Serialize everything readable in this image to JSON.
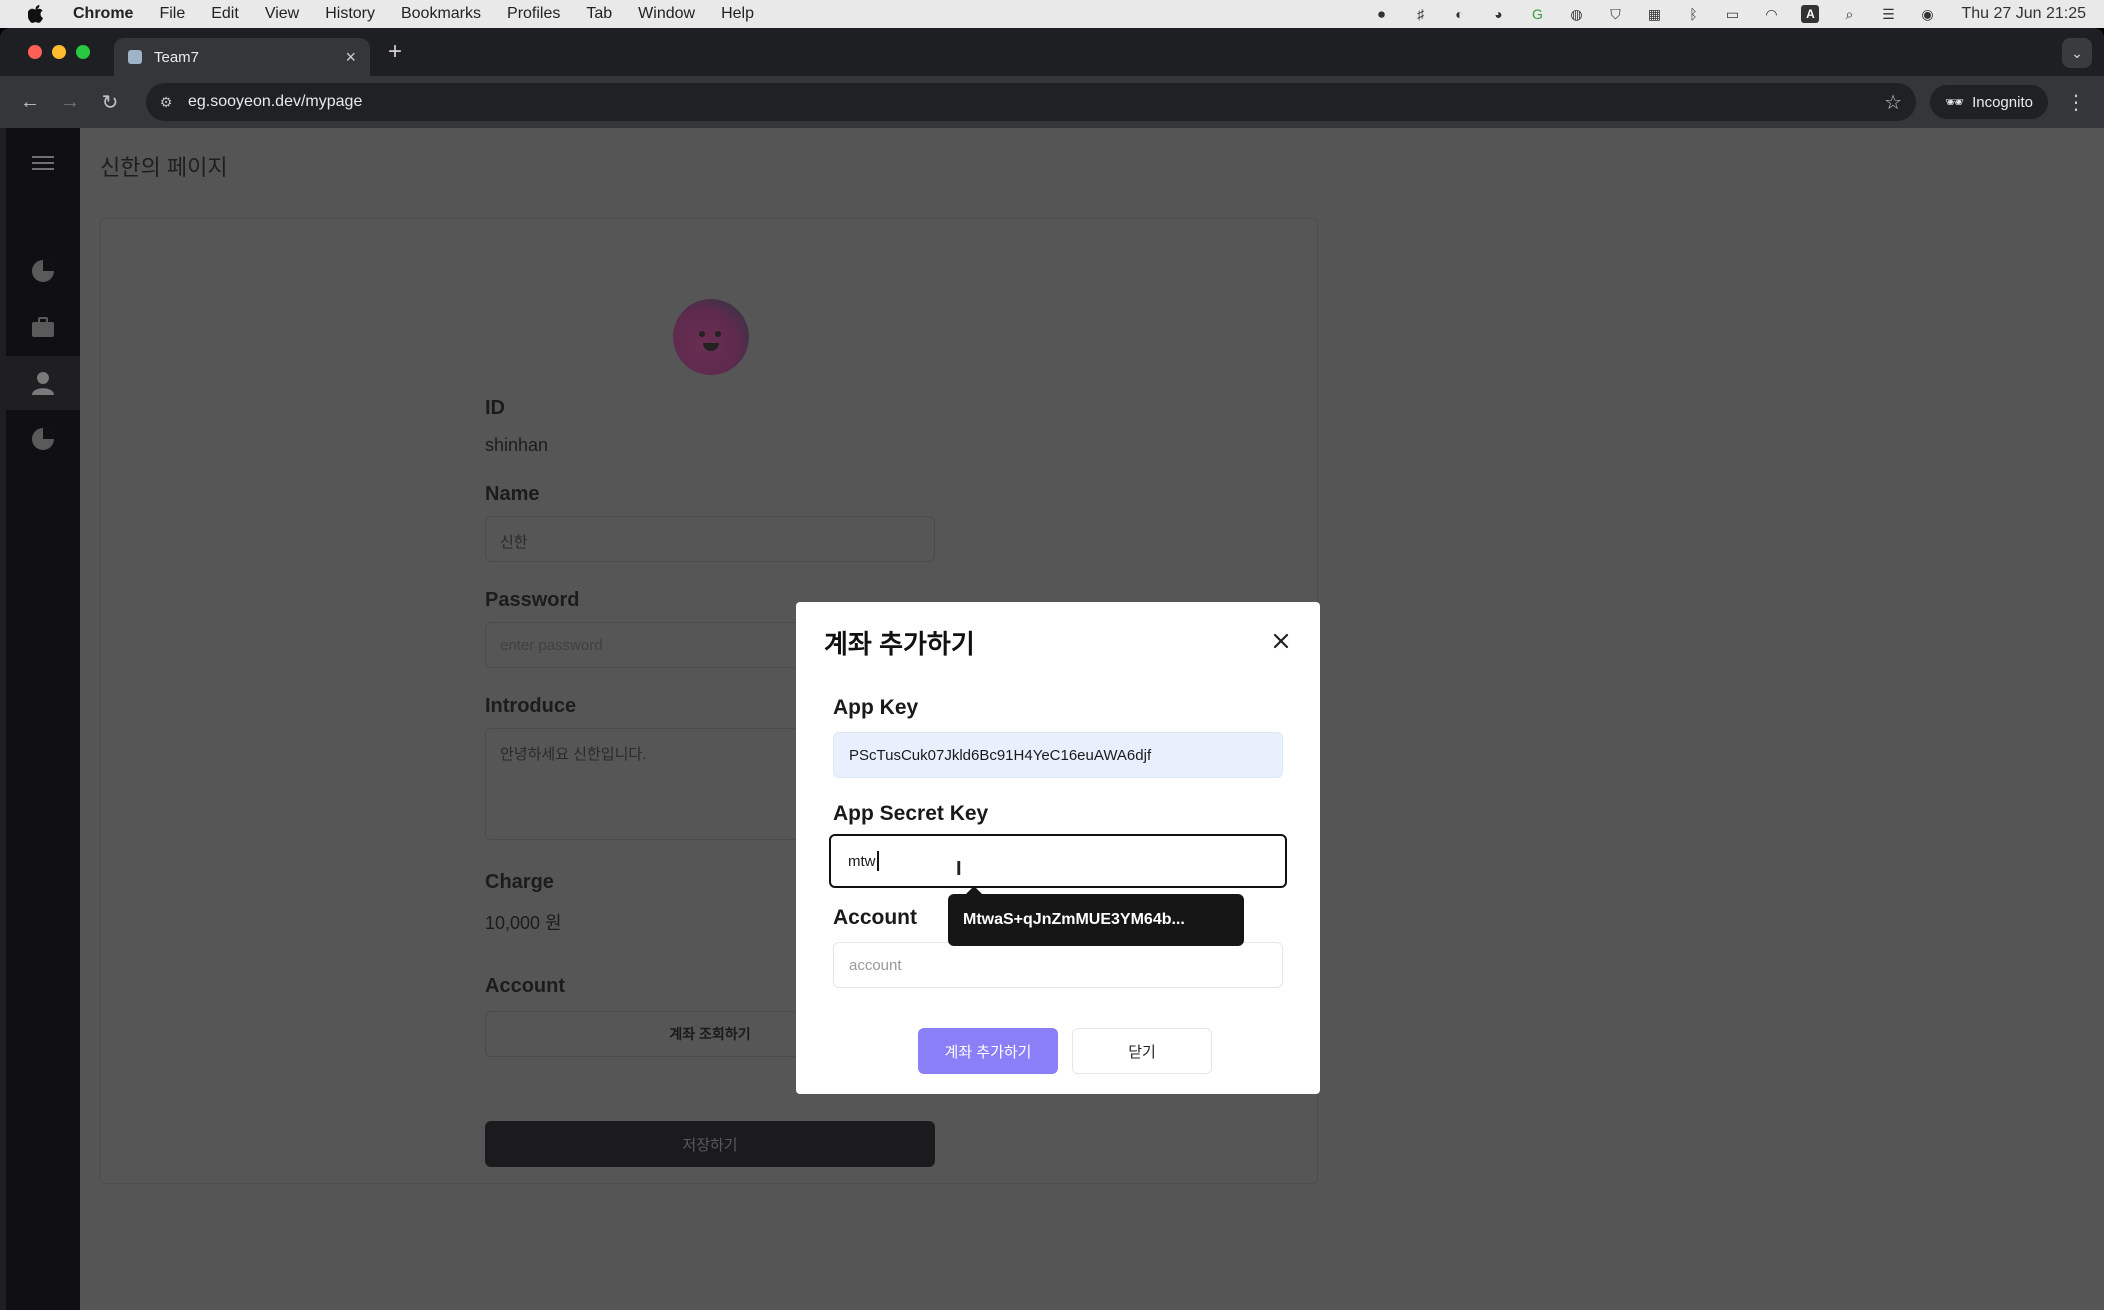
{
  "menubar": {
    "app": "Chrome",
    "items": [
      "File",
      "Edit",
      "View",
      "History",
      "Bookmarks",
      "Profiles",
      "Tab",
      "Window",
      "Help"
    ],
    "clock": "Thu 27 Jun  21:25"
  },
  "browser": {
    "tab_title": "Team7",
    "url": "eg.sooyeon.dev/mypage",
    "incognito_label": "Incognito"
  },
  "page": {
    "title": "신한의 페이지",
    "id_label": "ID",
    "id_value": "shinhan",
    "name_label": "Name",
    "name_value": "신한",
    "password_label": "Password",
    "password_placeholder": "enter password",
    "introduce_label": "Introduce",
    "introduce_value": "안녕하세요 신한입니다.",
    "charge_label": "Charge",
    "charge_value": "10,000 원",
    "account_label": "Account",
    "account_button": "계좌 조회하기",
    "save_button": "저장하기"
  },
  "modal": {
    "title": "계좌 추가하기",
    "app_key_label": "App Key",
    "app_key_value": "PScTusCuk07Jkld6Bc91H4YeC16euAWA6djf",
    "secret_label": "App Secret Key",
    "secret_value": "mtw",
    "autocomplete_suggestion": "MtwaS+qJnZmMUE3YM64b...",
    "account_label": "Account",
    "account_placeholder": "account",
    "submit_button": "계좌 추가하기",
    "close_button": "닫기"
  },
  "colors": {
    "primary_button": "#8b7ff7",
    "overlay": "#555555",
    "sidebar": "#101012"
  }
}
